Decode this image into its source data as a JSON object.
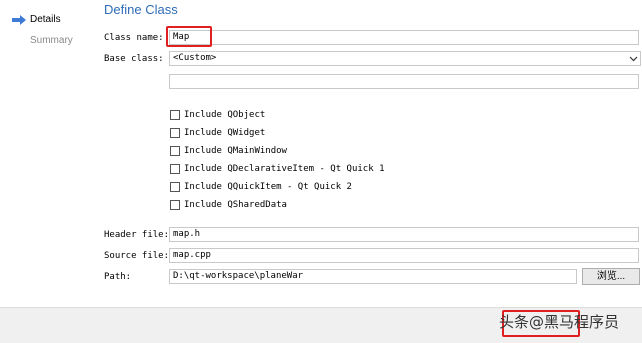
{
  "nav": {
    "steps": [
      "Details",
      "Summary"
    ],
    "accent_color": "#3d7bd4"
  },
  "page": {
    "title": "Define Class"
  },
  "form": {
    "class_name_label": "Class name:",
    "class_name_value": "Map",
    "base_class_label": "Base class:",
    "base_class_value": "<Custom>",
    "custom_base_value": "",
    "includes": [
      {
        "label": "Include QObject",
        "checked": false
      },
      {
        "label": "Include QWidget",
        "checked": false
      },
      {
        "label": "Include QMainWindow",
        "checked": false
      },
      {
        "label": "Include QDeclarativeItem - Qt Quick 1",
        "checked": false
      },
      {
        "label": "Include QQuickItem - Qt Quick 2",
        "checked": false
      },
      {
        "label": "Include QSharedData",
        "checked": false
      }
    ],
    "header_file_label": "Header file:",
    "header_file_value": "map.h",
    "source_file_label": "Source file:",
    "source_file_value": "map.cpp",
    "path_label": "Path:",
    "path_value": "D:\\qt-workspace\\planeWar",
    "browse_label": "浏览..."
  },
  "footer": {
    "watermark": "头条@黑马程序员"
  }
}
